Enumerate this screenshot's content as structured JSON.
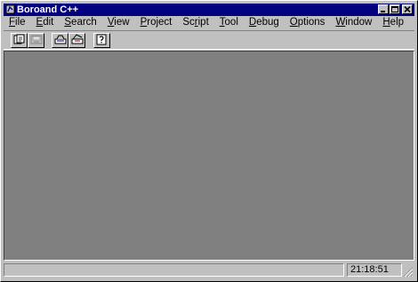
{
  "window": {
    "title": "Boroand C++",
    "controls": {
      "minimize": "minimize-icon",
      "maximize": "maximize-icon",
      "close": "close-icon"
    }
  },
  "menu": [
    {
      "pre": "",
      "key": "F",
      "post": "ile"
    },
    {
      "pre": "",
      "key": "E",
      "post": "dit"
    },
    {
      "pre": "",
      "key": "S",
      "post": "earch"
    },
    {
      "pre": "",
      "key": "V",
      "post": "iew"
    },
    {
      "pre": "",
      "key": "P",
      "post": "roject"
    },
    {
      "pre": "Sc",
      "key": "r",
      "post": "ipt"
    },
    {
      "pre": "",
      "key": "T",
      "post": "ool"
    },
    {
      "pre": "",
      "key": "D",
      "post": "ebug"
    },
    {
      "pre": "",
      "key": "O",
      "post": "ptions"
    },
    {
      "pre": "",
      "key": "W",
      "post": "indow"
    },
    {
      "pre": "",
      "key": "H",
      "post": "elp"
    }
  ],
  "toolbar": {
    "buttons": [
      "open-project-icon",
      "save-icon",
      "build-icon",
      "make-icon",
      "help-icon"
    ]
  },
  "statusbar": {
    "message": "",
    "time": "21:18:51"
  },
  "colors": {
    "face": "#c0c0c0",
    "titlebar": "#000080",
    "client": "#808080"
  }
}
